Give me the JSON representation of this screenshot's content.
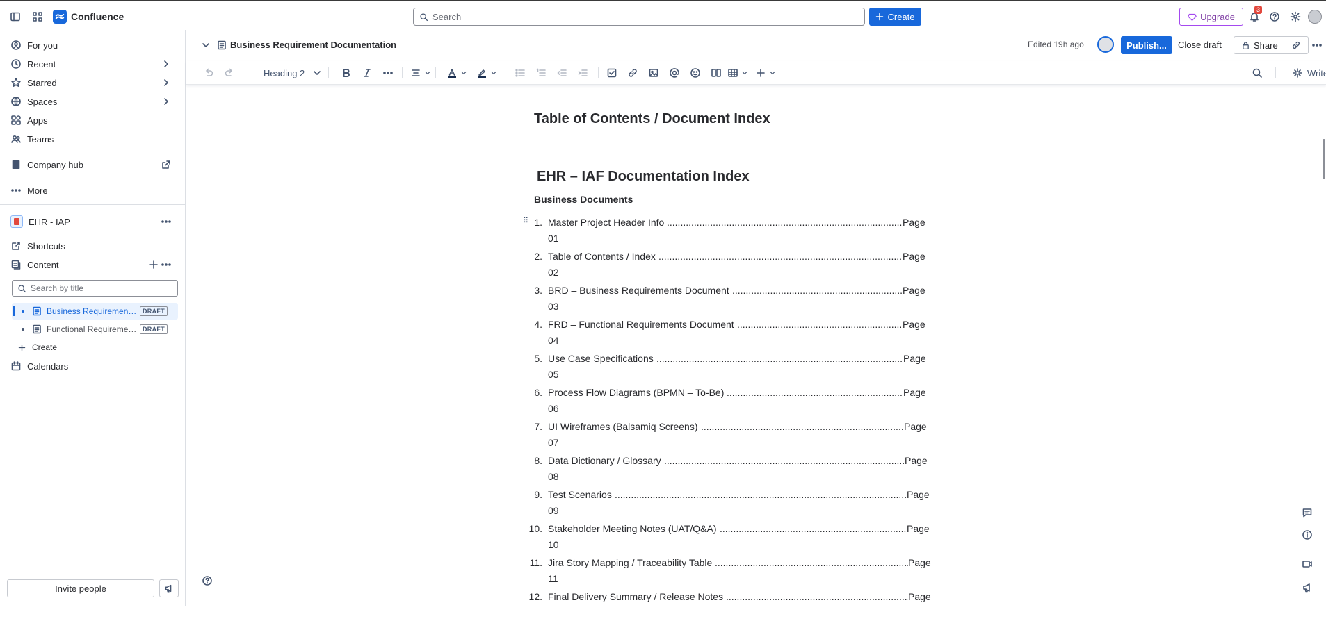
{
  "app": {
    "name": "Confluence",
    "brand_color": "#1868db"
  },
  "topbar": {
    "search_placeholder": "Search",
    "create_label": "Create",
    "upgrade_label": "Upgrade",
    "notification_count": "3"
  },
  "sidebar": {
    "nav": [
      {
        "label": "For you",
        "icon": "user-circle-icon"
      },
      {
        "label": "Recent",
        "icon": "clock-icon"
      },
      {
        "label": "Starred",
        "icon": "star-icon"
      },
      {
        "label": "Spaces",
        "icon": "globe-icon"
      },
      {
        "label": "Apps",
        "icon": "apps-icon"
      },
      {
        "label": "Teams",
        "icon": "people-icon"
      }
    ],
    "company_hub": "Company hub",
    "more": "More",
    "space_name": "EHR - IAP",
    "shortcuts": "Shortcuts",
    "content": "Content",
    "search_placeholder": "Search by title",
    "tree": [
      {
        "label": "Business Requirement Documentation",
        "badge": "DRAFT",
        "selected": true
      },
      {
        "label": "Functional Requirement Documentation",
        "badge": "DRAFT",
        "selected": false
      }
    ],
    "create": "Create",
    "calendars": "Calendars",
    "invite": "Invite people"
  },
  "page_header": {
    "title": "Business Requirement Documentation",
    "edited": "Edited 19h ago",
    "publish": "Publish...",
    "close_draft": "Close draft",
    "share": "Share"
  },
  "toolbar": {
    "text_style": "Heading 2",
    "write_label": "Write"
  },
  "document": {
    "heading_toc": "Table of Contents / Document Index",
    "heading_index": "EHR – IAF Documentation Index",
    "heading_business": "Business Documents",
    "page_word": "Page",
    "entries": [
      {
        "num": "1.",
        "text": "Master Project Header Info",
        "page": "01"
      },
      {
        "num": "2.",
        "text": "Table of Contents / Index",
        "page": "02"
      },
      {
        "num": "3.",
        "text": "BRD – Business Requirements Document",
        "page": "03"
      },
      {
        "num": "4.",
        "text": "FRD – Functional Requirements Document",
        "page": "04"
      },
      {
        "num": "5.",
        "text": "Use Case Specifications",
        "page": "05"
      },
      {
        "num": "6.",
        "text": "Process Flow Diagrams (BPMN – To-Be)",
        "page": "06"
      },
      {
        "num": "7.",
        "text": "UI Wireframes (Balsamiq Screens)",
        "page": "07"
      },
      {
        "num": "8.",
        "text": "Data Dictionary / Glossary",
        "page": "08"
      },
      {
        "num": "9.",
        "text": "Test Scenarios",
        "page": "09"
      },
      {
        "num": "10.",
        "text": "Stakeholder Meeting Notes (UAT/Q&A)",
        "page": "10"
      },
      {
        "num": "11.",
        "text": "Jira Story Mapping / Traceability Table",
        "page": "11"
      },
      {
        "num": "12.",
        "text": "Final Delivery Summary / Release Notes",
        "page": ""
      }
    ]
  }
}
